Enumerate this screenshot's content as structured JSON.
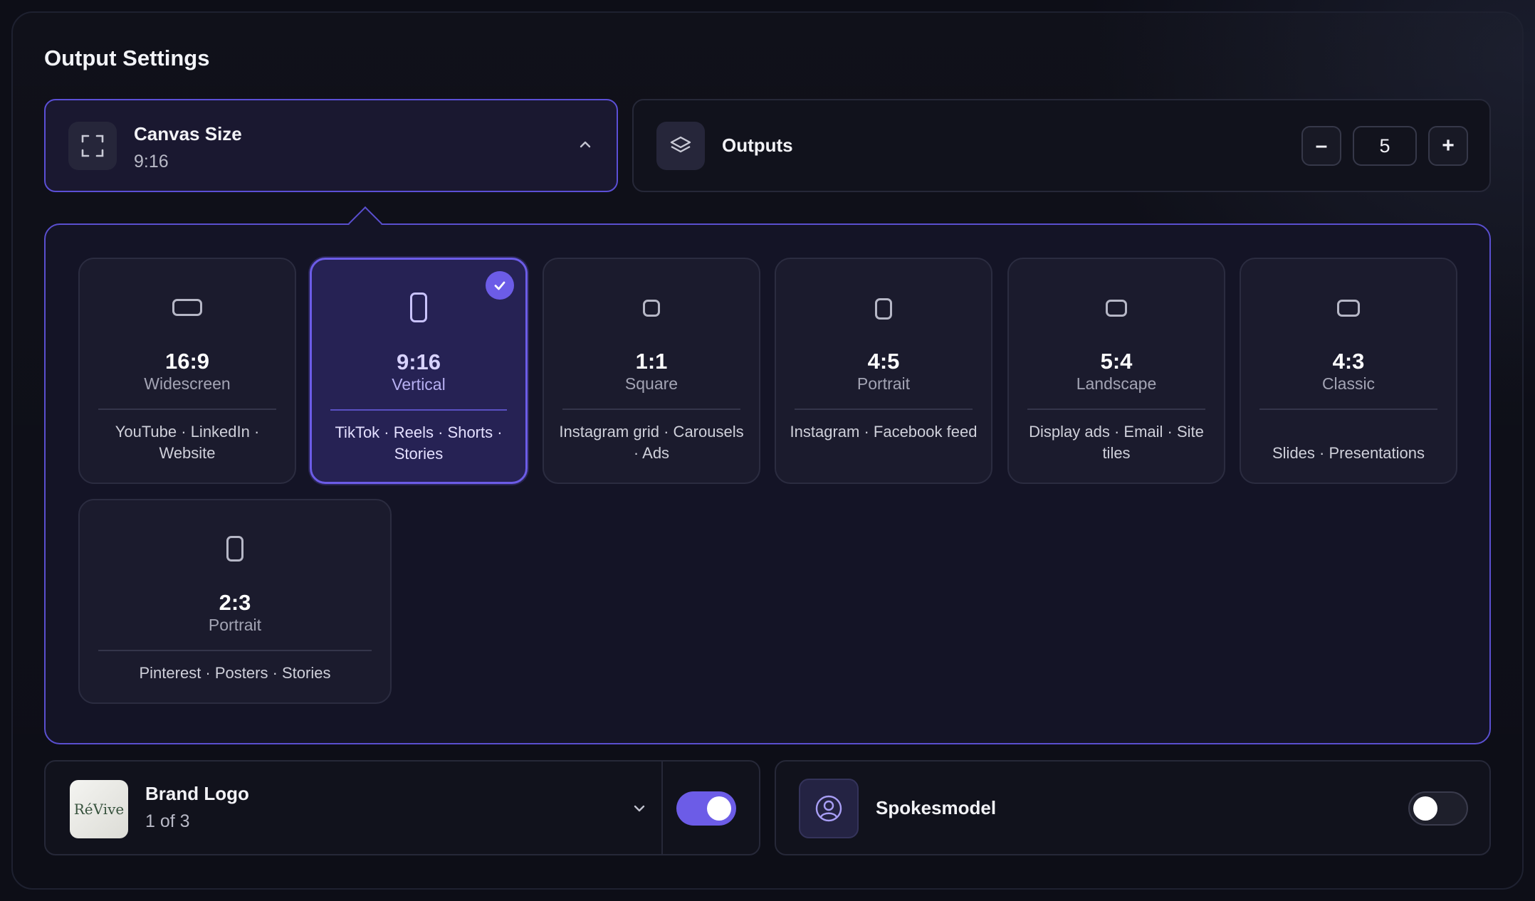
{
  "section_title": "Output Settings",
  "canvas_size": {
    "title": "Canvas Size",
    "value": "9:16",
    "icon": "expand-frame-icon",
    "toggle_icon": "chevron-up-icon"
  },
  "outputs": {
    "title": "Outputs",
    "icon": "layers-icon",
    "decrement_label": "–",
    "value": "5",
    "increment_label": "+"
  },
  "ratios": [
    {
      "ratio": "16:9",
      "name": "Widescreen",
      "uses": "YouTube · LinkedIn · Website",
      "selected": false
    },
    {
      "ratio": "9:16",
      "name": "Vertical",
      "uses": "TikTok · Reels · Shorts · Stories",
      "selected": true
    },
    {
      "ratio": "1:1",
      "name": "Square",
      "uses": "Instagram grid · Carousels · Ads",
      "selected": false
    },
    {
      "ratio": "4:5",
      "name": "Portrait",
      "uses": "Instagram · Facebook feed",
      "selected": false
    },
    {
      "ratio": "5:4",
      "name": "Landscape",
      "uses": "Display ads · Email · Site tiles",
      "selected": false
    },
    {
      "ratio": "4:3",
      "name": "Classic",
      "uses": "Slides · Presentations",
      "selected": false
    },
    {
      "ratio": "2:3",
      "name": "Portrait",
      "uses": "Pinterest · Posters · Stories",
      "selected": false
    }
  ],
  "brand_logo": {
    "title": "Brand Logo",
    "count": "1 of 3",
    "logo_text": "RéVive",
    "enabled": true
  },
  "spokesmodel": {
    "title": "Spokesmodel",
    "icon": "user-circle-icon",
    "enabled": false
  },
  "colors": {
    "accent": "#6c5ce7",
    "panel_border": "#5a4fcf",
    "background": "#0d0e17"
  }
}
